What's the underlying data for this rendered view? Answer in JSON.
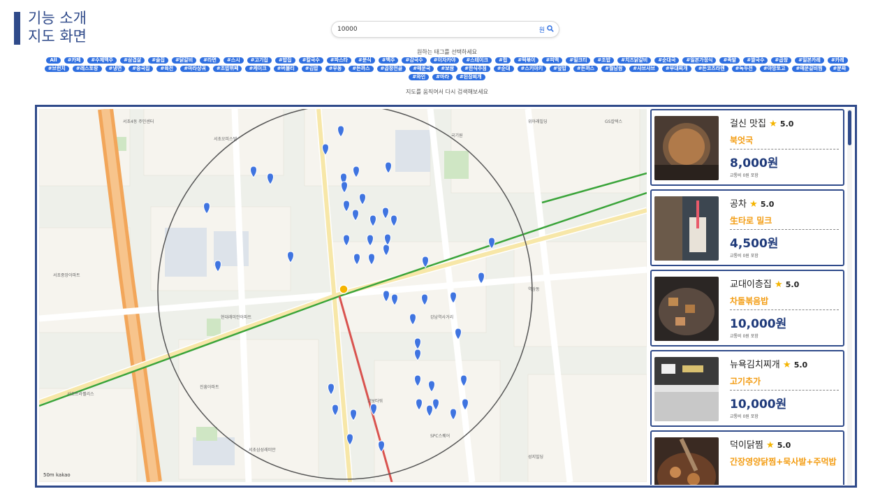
{
  "header": {
    "title_line1": "기능 소개",
    "title_line2": "지도 화면"
  },
  "search": {
    "value": "10000",
    "unit": "원",
    "icon": "search-icon"
  },
  "tag_prompt": "원하는 태그를 선택하세요",
  "tags": [
    "All",
    "#카페",
    "#수제맥주",
    "#삼겹살",
    "#술집",
    "#닭갈비",
    "#라면",
    "#스시",
    "#고기집",
    "#밥집",
    "#칼국수",
    "#파스타",
    "#분식",
    "#백주",
    "#감국수",
    "#이자카야",
    "#스테이크",
    "#펍",
    "#떡볶이",
    "#피맥",
    "#밀크티",
    "#조밥",
    "#치즈닭갈비",
    "#순대국",
    "#일본가정식",
    "#족발",
    "#쌀국수",
    "#곱창",
    "#일본카레",
    "#카레",
    "#브런치",
    "#레스토랑",
    "#냉면",
    "#중국집",
    "#육전",
    "#마라샹궈",
    "#초밥뷔페",
    "#케이크",
    "#버블티",
    "#김밥",
    "#우동",
    "#돈까스",
    "#곱창전골",
    "#매운국",
    "#보쌈",
    "#한식주점",
    "#순대",
    "#스키야키",
    "#덮밥",
    "#돈까스",
    "#월남쌈",
    "#샤브샤브",
    "#부대찌개",
    "#돈코츠라멘",
    "#녹두전",
    "#아망토고",
    "#매운갈비찜",
    "#분짜",
    "#와인",
    "#마라",
    "#된장찌개"
  ],
  "retry_text": "지도를 움직여서 다시 검색해보세요",
  "map": {
    "scale_label": "50m",
    "brand": "kakao"
  },
  "restaurants": [
    {
      "name": "걸신 맛집",
      "rating": "5.0",
      "menu": "북엇국",
      "price": "8,000원",
      "fee": "교통비 0원 포함"
    },
    {
      "name": "공차",
      "rating": "5.0",
      "menu": "生타로 밀크",
      "price": "4,500원",
      "fee": "교통비 0원 포함"
    },
    {
      "name": "교대이층집",
      "rating": "5.0",
      "menu": "차돌볶음밥",
      "price": "10,000원",
      "fee": "교통비 0원 포함"
    },
    {
      "name": "뉴욕김치찌개",
      "rating": "5.0",
      "menu": "고기추가",
      "price": "10,000원",
      "fee": "교통비 0원 포함"
    },
    {
      "name": "덕이닭찜",
      "rating": "5.0",
      "menu": "간장영양닭찜+묵사발+주먹밥",
      "price": "",
      "fee": ""
    }
  ],
  "colors": {
    "accent": "#2f4a8a",
    "tag": "#2f6fe0",
    "menu": "#f39c12",
    "price": "#1f3a7a"
  }
}
